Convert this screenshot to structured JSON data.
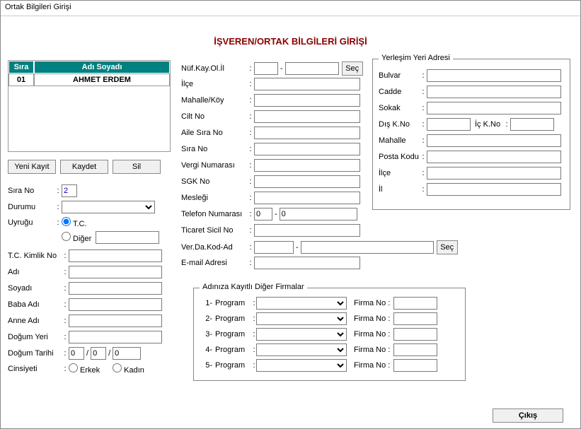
{
  "window": {
    "title": "Ortak Bilgileri Girişi"
  },
  "header": {
    "page_title": "İŞVEREN/ORTAK BİLGİLERİ GİRİŞİ"
  },
  "grid": {
    "cols": {
      "sira": "Sıra",
      "ad_soyadi": "Adı Soyadı"
    },
    "rows": [
      {
        "sira": "01",
        "ad_soyadi": "AHMET ERDEM"
      }
    ]
  },
  "buttons": {
    "yeni": "Yeni Kayıt",
    "kaydet": "Kaydet",
    "sil": "Sil",
    "cikis": "Çıkış",
    "sec": "Seç"
  },
  "left": {
    "sira_no": {
      "label": "Sıra No",
      "value": "2"
    },
    "durumu": {
      "label": "Durumu",
      "value": ""
    },
    "uyrugu": {
      "label": "Uyruğu",
      "tc": {
        "label": "T.C.",
        "checked": true
      },
      "diger": {
        "label": "Diğer",
        "checked": false,
        "value": ""
      }
    },
    "tc_kimlik": {
      "label": "T.C. Kimlik No",
      "value": ""
    },
    "adi": {
      "label": "Adı",
      "value": ""
    },
    "soyadi": {
      "label": "Soyadı",
      "value": ""
    },
    "baba_adi": {
      "label": "Baba Adı",
      "value": ""
    },
    "anne_adi": {
      "label": "Anne Adı",
      "value": ""
    },
    "dogum_yeri": {
      "label": "Doğum Yeri",
      "value": ""
    },
    "dogum_tarihi": {
      "label": "Doğum Tarihi",
      "g": "0",
      "a": "0",
      "y": "0",
      "sep": "/"
    },
    "cinsiyeti": {
      "label": "Cinsiyeti",
      "erkek": {
        "label": "Erkek",
        "checked": false
      },
      "kadin": {
        "label": "Kadın",
        "checked": false
      }
    }
  },
  "mid": {
    "nuf_kay": {
      "label": "Nüf.Kay.Ol.İl",
      "code": "",
      "name": "",
      "sep": "-"
    },
    "ilce": {
      "label": "İlçe",
      "value": ""
    },
    "mahalle_koy": {
      "label": "Mahalle/Köy",
      "value": ""
    },
    "cilt_no": {
      "label": "Cilt No",
      "value": ""
    },
    "aile_sira_no": {
      "label": "Aile Sıra No",
      "value": ""
    },
    "sira_no": {
      "label": "Sıra No",
      "value": ""
    },
    "vergi_no": {
      "label": "Vergi Numarası",
      "value": ""
    },
    "sgk_no": {
      "label": "SGK No",
      "value": ""
    },
    "meslegi": {
      "label": "Mesleği",
      "value": ""
    },
    "telefon": {
      "label": "Telefon Numarası",
      "area": "0",
      "num": "0",
      "sep": "-"
    },
    "ticaret_sicil": {
      "label": "Ticaret Sicil No",
      "value": ""
    },
    "ver_da": {
      "label": "Ver.Da.Kod-Ad",
      "kod": "",
      "ad": "",
      "sep": "-"
    },
    "email": {
      "label": "E-mail Adresi",
      "value": ""
    }
  },
  "adres": {
    "legend": "Yerleşim Yeri Adresi",
    "bulvar": {
      "label": "Bulvar",
      "value": ""
    },
    "cadde": {
      "label": "Cadde",
      "value": ""
    },
    "sokak": {
      "label": "Sokak",
      "value": ""
    },
    "dis_kno": {
      "label": "Dış K.No",
      "value": ""
    },
    "ic_kno": {
      "label": "İç K.No",
      "value": ""
    },
    "mahalle": {
      "label": "Mahalle",
      "value": ""
    },
    "posta_kodu": {
      "label": "Posta Kodu",
      "value": ""
    },
    "ilce": {
      "label": "İlçe",
      "value": ""
    },
    "il": {
      "label": "İl",
      "value": ""
    }
  },
  "firmalar": {
    "legend": "Adınıza Kayıtlı Diğer Firmalar",
    "program_label": "Program",
    "firma_no_label": "Firma No :",
    "rows": [
      {
        "num": "1-",
        "program": "",
        "firma_no": ""
      },
      {
        "num": "2-",
        "program": "",
        "firma_no": ""
      },
      {
        "num": "3-",
        "program": "",
        "firma_no": ""
      },
      {
        "num": "4-",
        "program": "",
        "firma_no": ""
      },
      {
        "num": "5-",
        "program": "",
        "firma_no": ""
      }
    ]
  }
}
